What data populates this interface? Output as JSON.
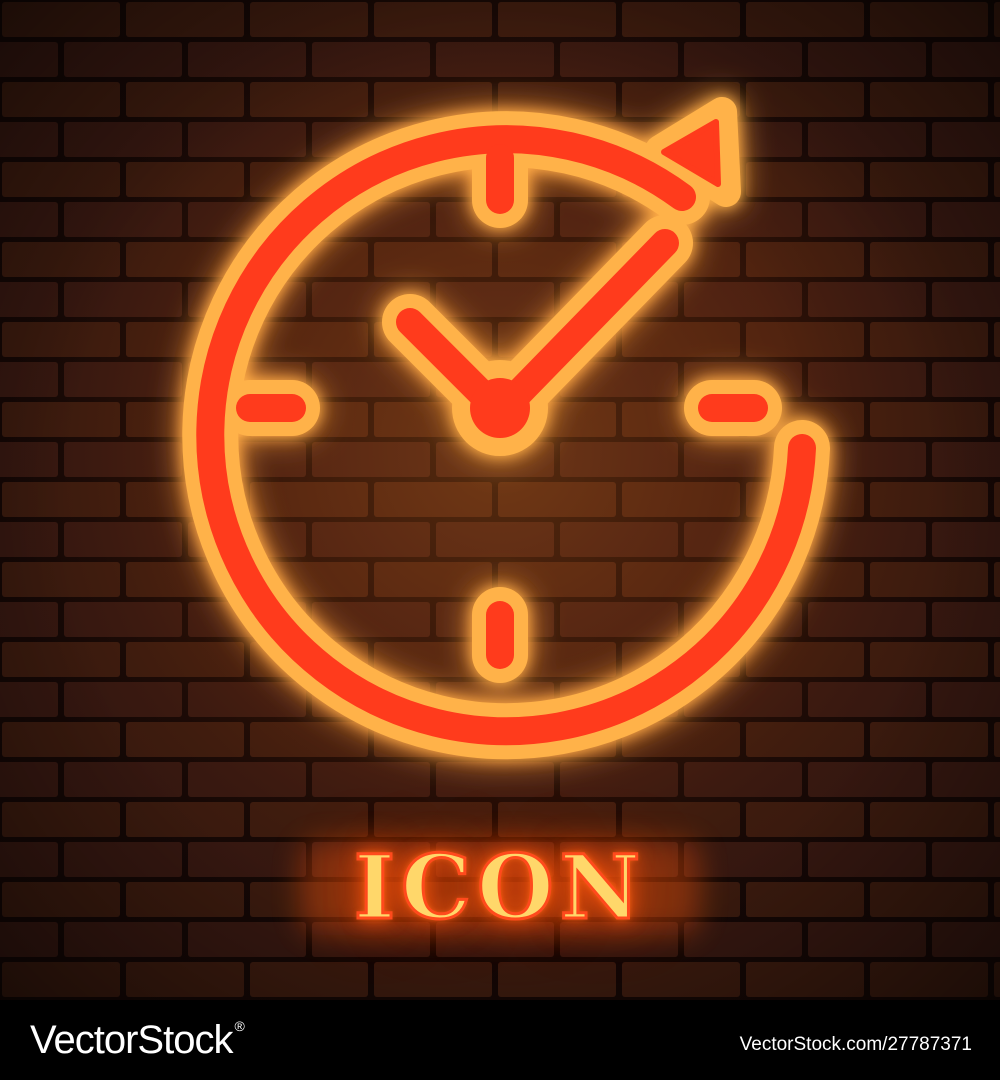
{
  "poster": {
    "headline": "ICON",
    "subject_icon": "clock-with-arrow-icon",
    "colors": {
      "brick": "#3a1a0e",
      "mortar": "#140705",
      "glow": "#ffb24a",
      "neon_fill": "#ff3a1c",
      "text_fill": "#ffd76a"
    }
  },
  "footer": {
    "brand": "VectorStock",
    "registered_mark": "®",
    "stock_id": "VectorStock.com/27787371"
  }
}
